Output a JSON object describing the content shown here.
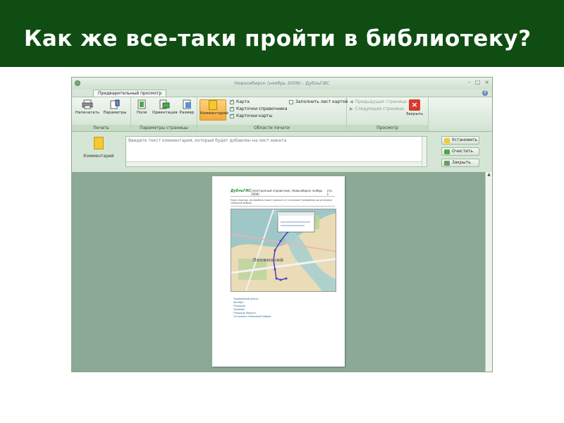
{
  "slide": {
    "title": "Как же все-таки пройти в библиотеку?"
  },
  "window": {
    "title": "Новосибирск (ноябрь 2008) - ДубльГИС",
    "tab": "Предварительный просмотр"
  },
  "ribbon": {
    "print_group": {
      "label": "Печать",
      "buttons": [
        "Напечатать",
        "Параметры"
      ]
    },
    "page_params_group": {
      "label": "Параметры страницы",
      "buttons": [
        "Поля",
        "Ориентация",
        "Размер"
      ]
    },
    "print_areas_group": {
      "label": "Области печати",
      "comment_button": "Комментарий",
      "checks": [
        {
          "label": "Карта",
          "checked": true
        },
        {
          "label": "Карточки справочника",
          "checked": true
        },
        {
          "label": "Карточки карты",
          "checked": true
        }
      ],
      "fill_sheet": {
        "label": "Заполнить лист картой",
        "checked": false
      }
    },
    "view_group": {
      "label": "Просмотр",
      "prev_page": "Предыдущая страница",
      "next_page": "Следующая страница",
      "close_button": "Закрыть"
    }
  },
  "comment": {
    "icon_label": "Комментарий",
    "placeholder": "Введите текст комментария, который будет добавлен на лист макета",
    "buttons": [
      "Установить",
      "Очистить",
      "Закрыть"
    ]
  },
  "preview_page": {
    "logo": "ДубльГИС",
    "header_text": "(электронный справочник, Новосибирск ноябрь 2008)",
    "page_number": "стр. 1",
    "description": "Поиск проезда. Автомобиль может проехать от остановки Трамвайная до остановки Северный Бобров",
    "map_labels": [
      "Ленинский"
    ],
    "route_lines": [
      "Трамвайный рынок",
      "Автобус",
      "Площадь",
      "Трамвай",
      "Площадь Маркса",
      "Остановка Северный Бобров"
    ]
  },
  "colors": {
    "slide_header": "#0f4d12",
    "app_bg": "#d4e4d4",
    "preview_bg": "#8ca996",
    "accent": "#f2a93a"
  }
}
